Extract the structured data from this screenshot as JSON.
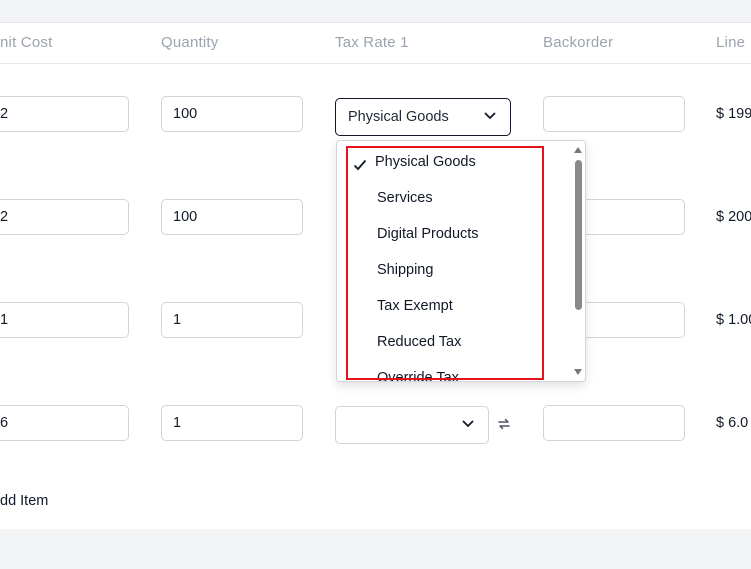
{
  "table": {
    "headers": {
      "unit_cost": "nit Cost",
      "quantity": "Quantity",
      "tax_rate": "Tax Rate 1",
      "backorder": "Backorder",
      "line_total": "Line"
    },
    "rows": [
      {
        "unit_cost": "2",
        "quantity": "100",
        "tax_rate": "Physical Goods",
        "backorder": "",
        "line_total": "$ 199"
      },
      {
        "unit_cost": "2",
        "quantity": "100",
        "tax_rate": "",
        "backorder": "",
        "line_total": "$ 200"
      },
      {
        "unit_cost": "1",
        "quantity": "1",
        "tax_rate": "",
        "backorder": "",
        "line_total": "$ 1.00"
      },
      {
        "unit_cost": "6",
        "quantity": "1",
        "tax_rate": "",
        "backorder": "",
        "line_total": "$ 6.0"
      }
    ],
    "add_item_label": "dd Item"
  },
  "tax_dropdown": {
    "selected": "Physical Goods",
    "options": [
      "Physical Goods",
      "Services",
      "Digital Products",
      "Shipping",
      "Tax Exempt",
      "Reduced Tax",
      "Override Tax"
    ]
  },
  "colors": {
    "highlight_border": "#e4121d",
    "header_text": "#9ca3af",
    "border": "#d1d5db"
  },
  "icons": {
    "chevron": "chevron-down-icon",
    "swap": "swap-icon",
    "check": "check-icon"
  }
}
